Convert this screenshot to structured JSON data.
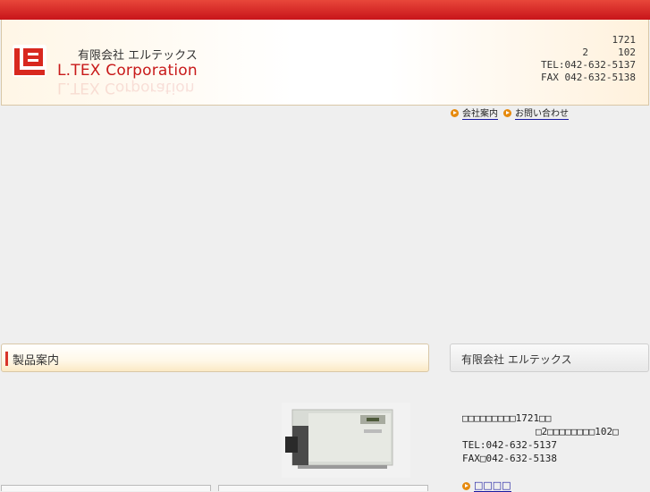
{
  "header": {
    "company_jp": "有限会社 エルテックス",
    "company_en": "L.TEX Corporation",
    "address_lines": [
      "1721",
      "2     102",
      "TEL:042-632-5137",
      "FAX 042-632-5138"
    ]
  },
  "nav": {
    "items": [
      "会社案内",
      "お問い合わせ"
    ]
  },
  "products_panel": {
    "title": "製品案内"
  },
  "company_panel": {
    "title": "有限会社 エルテックス",
    "address_line1": "□□□□□□□□□1721□□",
    "address_line2": "□2□□□□□□□□102□",
    "tel": "TEL:042-632-5137",
    "fax": "FAX□042-632-5138",
    "link": "□□□□"
  },
  "colors": {
    "accent": "#c81a1a",
    "nav_arrow": "#e68a0e",
    "link": "#1a1aa0"
  }
}
